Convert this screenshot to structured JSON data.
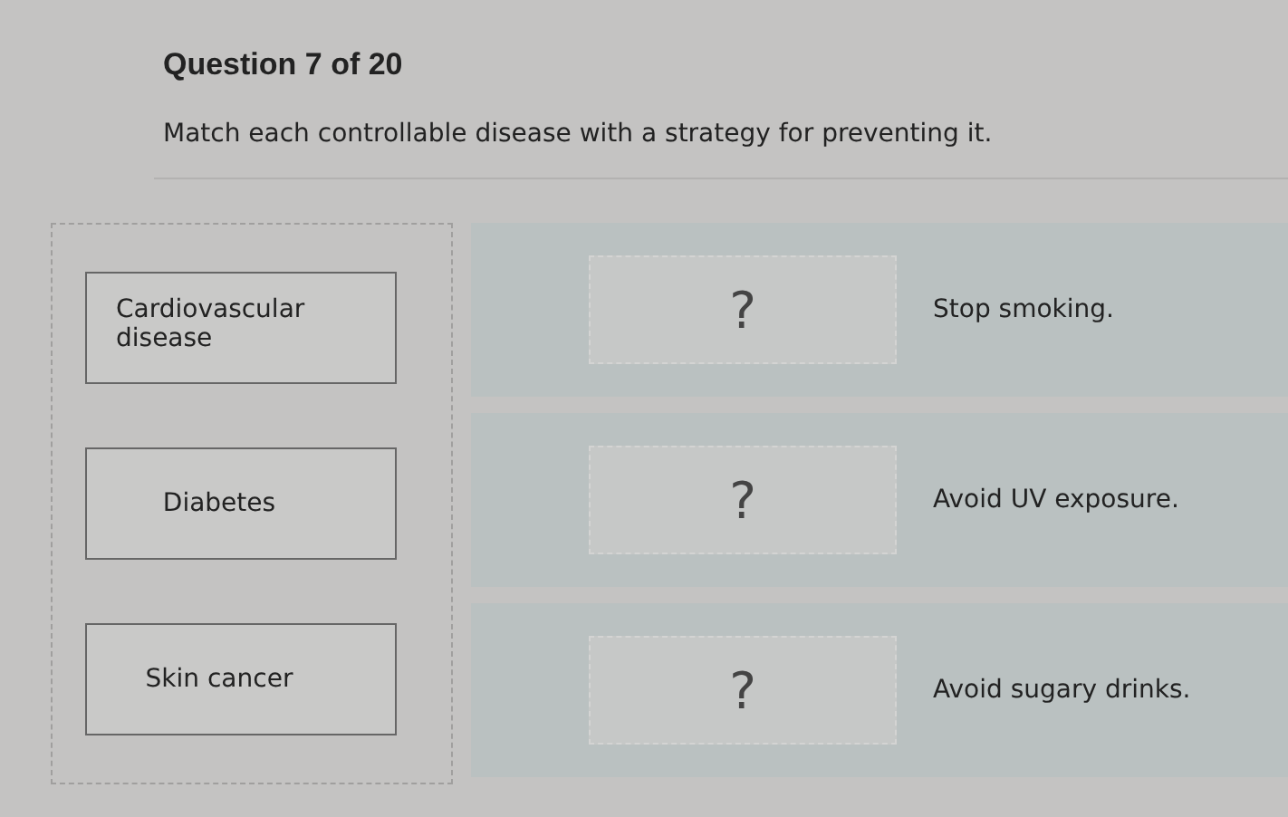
{
  "question": {
    "title": "Question 7 of 20",
    "prompt": "Match each controllable disease with a strategy for preventing it."
  },
  "tiles": [
    {
      "label": "Cardiovascular disease"
    },
    {
      "label": "Diabetes"
    },
    {
      "label": "Skin cancer"
    }
  ],
  "targets": [
    {
      "slot": "?",
      "strategy": "Stop smoking."
    },
    {
      "slot": "?",
      "strategy": "Avoid UV exposure."
    },
    {
      "slot": "?",
      "strategy": "Avoid sugary drinks."
    }
  ]
}
